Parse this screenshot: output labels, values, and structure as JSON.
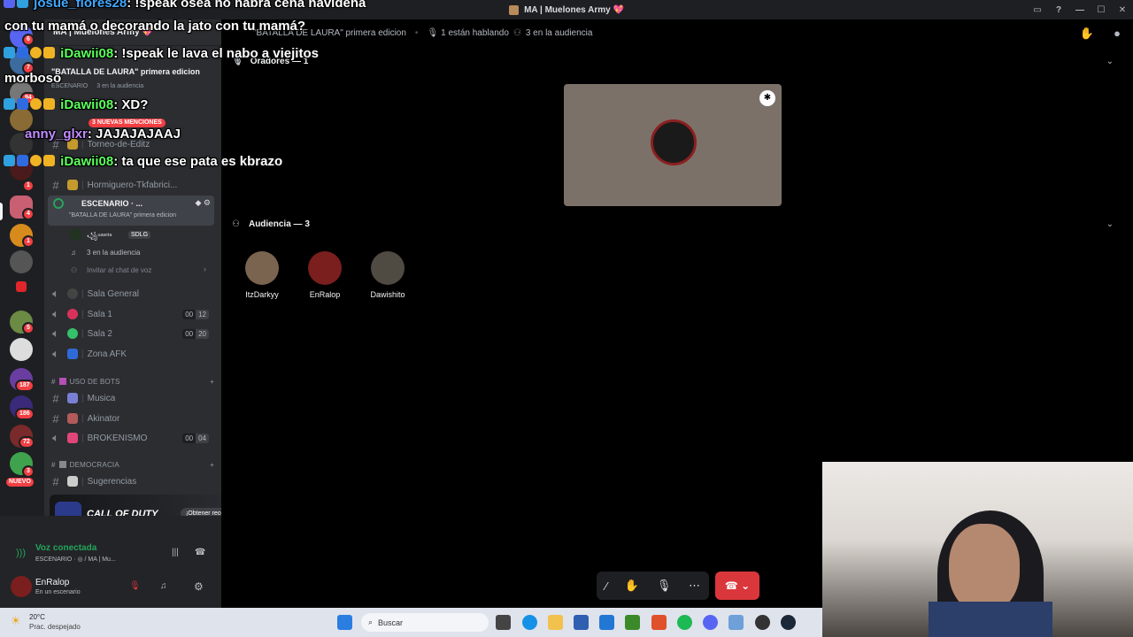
{
  "window": {
    "title": "MA | Muelones Army 💖"
  },
  "server": {
    "name": "MA | Muelones Army 💖"
  },
  "rail_badges": [
    "6",
    "7",
    "94",
    "1",
    "4",
    "1",
    "5",
    "5",
    "3",
    "187",
    "186",
    "72",
    "3"
  ],
  "rail_new": "NUEVO",
  "event": {
    "title": "\"BATALLA DE LAURA\" primera edicion",
    "stage": "ESCENARIO",
    "audience": "3 en la audiencia"
  },
  "mentions": "3 NUEVAS MENCIONES",
  "channels": {
    "torneo": "Torneo-de-Editz",
    "hormiguero": "Hormiguero-Tkfabrici...",
    "stage_name": "ESCENARIO · ...",
    "stage_topic": "\"BATALLA DE LAURA\" primera edicion",
    "stage_user": "꧁ᵘᵃʷᶦᵗᵃ",
    "stage_user_tag": "SDLG",
    "stage_audience": "3 en la audiencia",
    "invite": "Invitar al chat de voz",
    "sala_general": "Sala General",
    "sala1": "Sala 1",
    "sala1_count": [
      "00",
      "12"
    ],
    "sala2": "Sala 2",
    "sala2_count": [
      "00",
      "20"
    ],
    "zona_afk": "Zona AFK",
    "cat_bots": "USO DE BOTS",
    "musica": "Musica",
    "akinator": "Akinator",
    "brokenismo": "BROKENISMO",
    "broken_count": [
      "00",
      "04"
    ],
    "cat_democracia": "DEMOCRACIA",
    "sugerencias": "Sugerencias"
  },
  "promo": {
    "game": "CALL OF DUTY",
    "button": "¡Obtener recompensa!"
  },
  "voice": {
    "status": "Voz conectada",
    "location": "ESCENARIO · ◎ / MA | Mu..."
  },
  "user": {
    "name": "EnRalop",
    "status": "En un escenario"
  },
  "header": {
    "title": "\"BATALLA DE LAURA\" primera edicion",
    "speaking": "1 están hablando",
    "audience": "3 en la audiencia"
  },
  "speakers": {
    "label": "Oradores — 1"
  },
  "audience": {
    "label": "Audiencia — 3",
    "members": [
      "ItzDarkyy",
      "EnRalop",
      "Dawishito"
    ]
  },
  "taskbar": {
    "temp": "20°C",
    "weather": "Prac. despejado",
    "search": "Buscar"
  },
  "overlay": [
    {
      "user": "josue_flores28",
      "msg": ": !speak osea no habra cena navideña"
    },
    {
      "user": "",
      "msg": "con tu mamá o decorando la jato con tu mamá?"
    },
    {
      "user": "iDawii08",
      "msg": ": !speak le lava el nabo a viejitos"
    },
    {
      "user": "",
      "msg": "morboso"
    },
    {
      "user": "iDawii08",
      "msg": ": XD?"
    },
    {
      "user": "anny_glxr",
      "msg": ": JAJAJAJAAJ"
    },
    {
      "user": "iDawii08",
      "msg": ": ta que ese pata es kbrazo"
    }
  ]
}
